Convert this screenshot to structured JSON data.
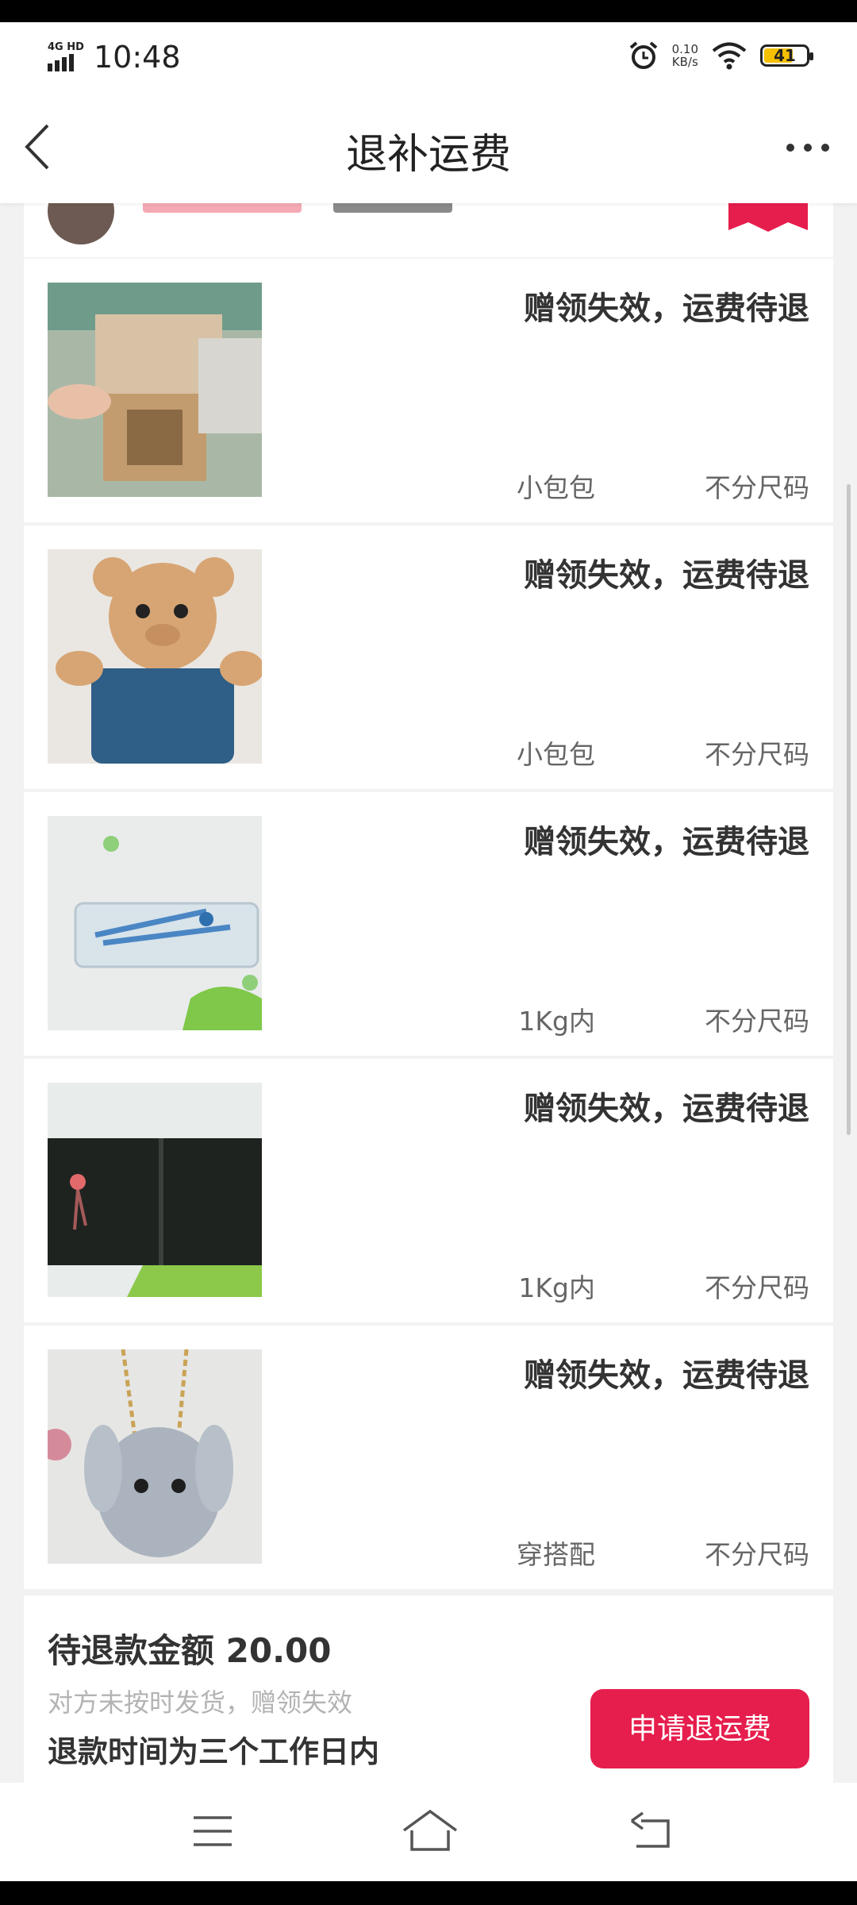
{
  "status_bar": {
    "network": "4G HD",
    "time": "10:48",
    "speed_value": "0.10",
    "speed_unit": "KB/s",
    "battery": "41",
    "icons": [
      "signal-icon",
      "alarm-icon",
      "wifi-icon",
      "battery-icon"
    ]
  },
  "nav": {
    "title": "退补运费",
    "back_icon": "chevron-left-icon",
    "more_icon": "more-dots-icon"
  },
  "items": [
    {
      "status": "赠领失效，运费待退",
      "tag": "小包包",
      "size": "不分尺码",
      "image": "wallet-photo"
    },
    {
      "status": "赠领失效，运费待退",
      "tag": "小包包",
      "size": "不分尺码",
      "image": "teddy-bear-photo"
    },
    {
      "status": "赠领失效，运费待退",
      "tag": "1Kg内",
      "size": "不分尺码",
      "image": "compass-set-photo"
    },
    {
      "status": "赠领失效，运费待退",
      "tag": "1Kg内",
      "size": "不分尺码",
      "image": "black-wallet-photo"
    },
    {
      "status": "赠领失效，运费待退",
      "tag": "穿搭配",
      "size": "不分尺码",
      "image": "bunny-bag-photo"
    }
  ],
  "footer": {
    "amount_label": "待退款金额 20.00",
    "reason": "对方未按时发货，赠领失效",
    "refund_time": "退款时间为三个工作日内",
    "apply_button": "申请退运费"
  },
  "colors": {
    "accent": "#e61e4d",
    "background": "#f2f2f2"
  },
  "system_nav": [
    "menu-icon",
    "home-icon",
    "back-return-icon"
  ]
}
